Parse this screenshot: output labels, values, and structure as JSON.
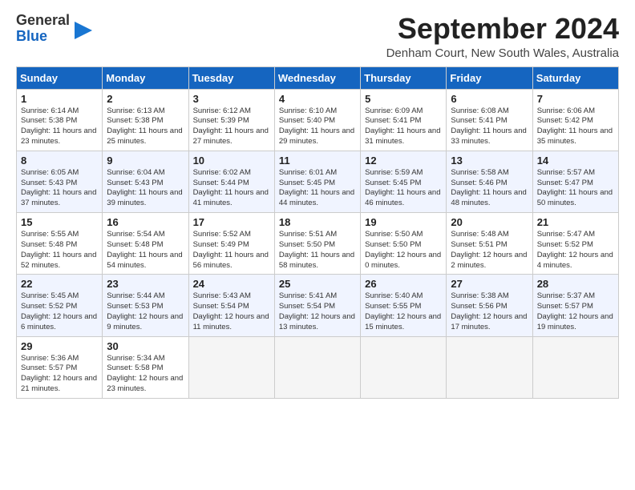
{
  "header": {
    "logo_general": "General",
    "logo_blue": "Blue",
    "month_title": "September 2024",
    "location": "Denham Court, New South Wales, Australia"
  },
  "weekdays": [
    "Sunday",
    "Monday",
    "Tuesday",
    "Wednesday",
    "Thursday",
    "Friday",
    "Saturday"
  ],
  "weeks": [
    [
      {
        "day": "1",
        "sunrise": "Sunrise: 6:14 AM",
        "sunset": "Sunset: 5:38 PM",
        "daylight": "Daylight: 11 hours and 23 minutes."
      },
      {
        "day": "2",
        "sunrise": "Sunrise: 6:13 AM",
        "sunset": "Sunset: 5:38 PM",
        "daylight": "Daylight: 11 hours and 25 minutes."
      },
      {
        "day": "3",
        "sunrise": "Sunrise: 6:12 AM",
        "sunset": "Sunset: 5:39 PM",
        "daylight": "Daylight: 11 hours and 27 minutes."
      },
      {
        "day": "4",
        "sunrise": "Sunrise: 6:10 AM",
        "sunset": "Sunset: 5:40 PM",
        "daylight": "Daylight: 11 hours and 29 minutes."
      },
      {
        "day": "5",
        "sunrise": "Sunrise: 6:09 AM",
        "sunset": "Sunset: 5:41 PM",
        "daylight": "Daylight: 11 hours and 31 minutes."
      },
      {
        "day": "6",
        "sunrise": "Sunrise: 6:08 AM",
        "sunset": "Sunset: 5:41 PM",
        "daylight": "Daylight: 11 hours and 33 minutes."
      },
      {
        "day": "7",
        "sunrise": "Sunrise: 6:06 AM",
        "sunset": "Sunset: 5:42 PM",
        "daylight": "Daylight: 11 hours and 35 minutes."
      }
    ],
    [
      {
        "day": "8",
        "sunrise": "Sunrise: 6:05 AM",
        "sunset": "Sunset: 5:43 PM",
        "daylight": "Daylight: 11 hours and 37 minutes."
      },
      {
        "day": "9",
        "sunrise": "Sunrise: 6:04 AM",
        "sunset": "Sunset: 5:43 PM",
        "daylight": "Daylight: 11 hours and 39 minutes."
      },
      {
        "day": "10",
        "sunrise": "Sunrise: 6:02 AM",
        "sunset": "Sunset: 5:44 PM",
        "daylight": "Daylight: 11 hours and 41 minutes."
      },
      {
        "day": "11",
        "sunrise": "Sunrise: 6:01 AM",
        "sunset": "Sunset: 5:45 PM",
        "daylight": "Daylight: 11 hours and 44 minutes."
      },
      {
        "day": "12",
        "sunrise": "Sunrise: 5:59 AM",
        "sunset": "Sunset: 5:45 PM",
        "daylight": "Daylight: 11 hours and 46 minutes."
      },
      {
        "day": "13",
        "sunrise": "Sunrise: 5:58 AM",
        "sunset": "Sunset: 5:46 PM",
        "daylight": "Daylight: 11 hours and 48 minutes."
      },
      {
        "day": "14",
        "sunrise": "Sunrise: 5:57 AM",
        "sunset": "Sunset: 5:47 PM",
        "daylight": "Daylight: 11 hours and 50 minutes."
      }
    ],
    [
      {
        "day": "15",
        "sunrise": "Sunrise: 5:55 AM",
        "sunset": "Sunset: 5:48 PM",
        "daylight": "Daylight: 11 hours and 52 minutes."
      },
      {
        "day": "16",
        "sunrise": "Sunrise: 5:54 AM",
        "sunset": "Sunset: 5:48 PM",
        "daylight": "Daylight: 11 hours and 54 minutes."
      },
      {
        "day": "17",
        "sunrise": "Sunrise: 5:52 AM",
        "sunset": "Sunset: 5:49 PM",
        "daylight": "Daylight: 11 hours and 56 minutes."
      },
      {
        "day": "18",
        "sunrise": "Sunrise: 5:51 AM",
        "sunset": "Sunset: 5:50 PM",
        "daylight": "Daylight: 11 hours and 58 minutes."
      },
      {
        "day": "19",
        "sunrise": "Sunrise: 5:50 AM",
        "sunset": "Sunset: 5:50 PM",
        "daylight": "Daylight: 12 hours and 0 minutes."
      },
      {
        "day": "20",
        "sunrise": "Sunrise: 5:48 AM",
        "sunset": "Sunset: 5:51 PM",
        "daylight": "Daylight: 12 hours and 2 minutes."
      },
      {
        "day": "21",
        "sunrise": "Sunrise: 5:47 AM",
        "sunset": "Sunset: 5:52 PM",
        "daylight": "Daylight: 12 hours and 4 minutes."
      }
    ],
    [
      {
        "day": "22",
        "sunrise": "Sunrise: 5:45 AM",
        "sunset": "Sunset: 5:52 PM",
        "daylight": "Daylight: 12 hours and 6 minutes."
      },
      {
        "day": "23",
        "sunrise": "Sunrise: 5:44 AM",
        "sunset": "Sunset: 5:53 PM",
        "daylight": "Daylight: 12 hours and 9 minutes."
      },
      {
        "day": "24",
        "sunrise": "Sunrise: 5:43 AM",
        "sunset": "Sunset: 5:54 PM",
        "daylight": "Daylight: 12 hours and 11 minutes."
      },
      {
        "day": "25",
        "sunrise": "Sunrise: 5:41 AM",
        "sunset": "Sunset: 5:54 PM",
        "daylight": "Daylight: 12 hours and 13 minutes."
      },
      {
        "day": "26",
        "sunrise": "Sunrise: 5:40 AM",
        "sunset": "Sunset: 5:55 PM",
        "daylight": "Daylight: 12 hours and 15 minutes."
      },
      {
        "day": "27",
        "sunrise": "Sunrise: 5:38 AM",
        "sunset": "Sunset: 5:56 PM",
        "daylight": "Daylight: 12 hours and 17 minutes."
      },
      {
        "day": "28",
        "sunrise": "Sunrise: 5:37 AM",
        "sunset": "Sunset: 5:57 PM",
        "daylight": "Daylight: 12 hours and 19 minutes."
      }
    ],
    [
      {
        "day": "29",
        "sunrise": "Sunrise: 5:36 AM",
        "sunset": "Sunset: 5:57 PM",
        "daylight": "Daylight: 12 hours and 21 minutes."
      },
      {
        "day": "30",
        "sunrise": "Sunrise: 5:34 AM",
        "sunset": "Sunset: 5:58 PM",
        "daylight": "Daylight: 12 hours and 23 minutes."
      },
      null,
      null,
      null,
      null,
      null
    ]
  ]
}
